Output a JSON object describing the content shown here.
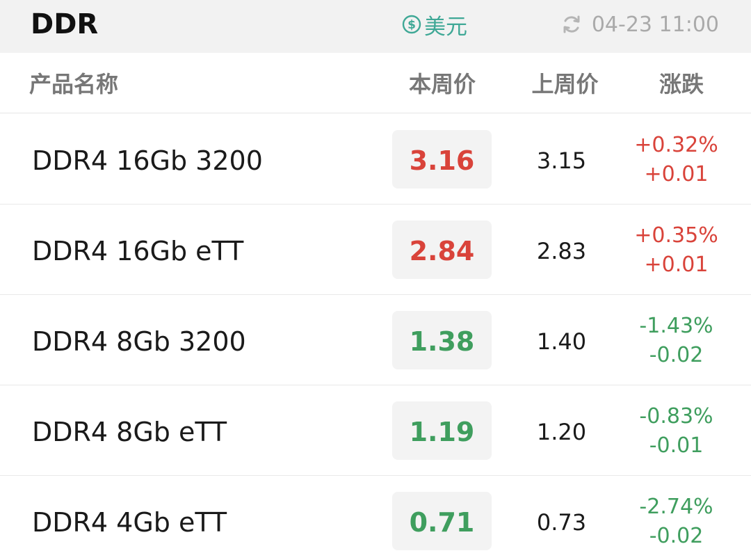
{
  "header": {
    "title": "DDR",
    "currency_label": "美元",
    "currency_icon": "dollar-circle-icon",
    "refresh_icon": "refresh-icon",
    "update_time": "04-23 11:00"
  },
  "columns": {
    "name": "产品名称",
    "current": "本周价",
    "previous": "上周价",
    "change": "涨跌"
  },
  "colors": {
    "up": "#d9433a",
    "down": "#3f9e5e",
    "accent": "#3fa896"
  },
  "rows": [
    {
      "name": "DDR4 16Gb 3200",
      "current": "3.16",
      "previous": "3.15",
      "change_pct": "+0.32%",
      "change_abs": "+0.01",
      "direction": "up"
    },
    {
      "name": "DDR4 16Gb eTT",
      "current": "2.84",
      "previous": "2.83",
      "change_pct": "+0.35%",
      "change_abs": "+0.01",
      "direction": "up"
    },
    {
      "name": "DDR4 8Gb 3200",
      "current": "1.38",
      "previous": "1.40",
      "change_pct": "-1.43%",
      "change_abs": "-0.02",
      "direction": "down"
    },
    {
      "name": "DDR4 8Gb eTT",
      "current": "1.19",
      "previous": "1.20",
      "change_pct": "-0.83%",
      "change_abs": "-0.01",
      "direction": "down"
    },
    {
      "name": "DDR4 4Gb eTT",
      "current": "0.71",
      "previous": "0.73",
      "change_pct": "-2.74%",
      "change_abs": "-0.02",
      "direction": "down"
    }
  ]
}
